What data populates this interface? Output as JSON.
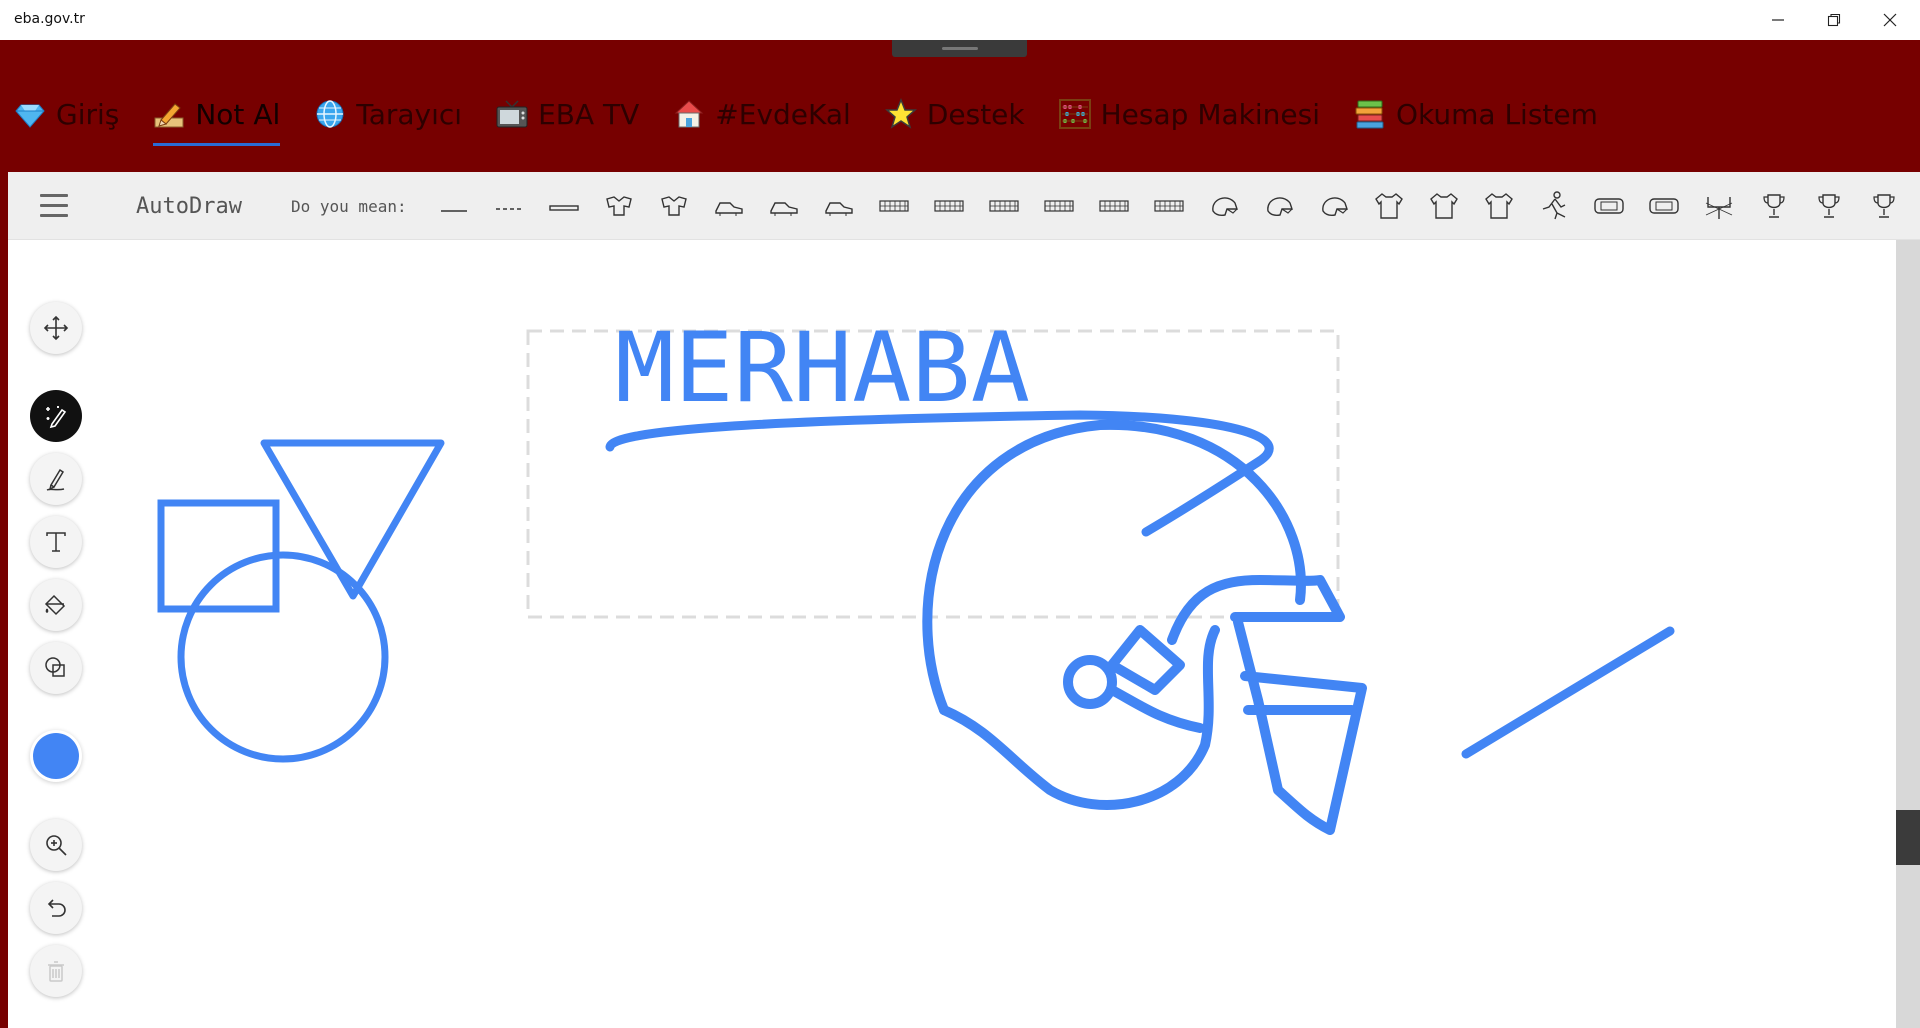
{
  "window": {
    "title": "eba.gov.tr",
    "controls": [
      "minimize",
      "restore",
      "close"
    ]
  },
  "nav": {
    "items": [
      {
        "label": "Giriş",
        "icon": "diamond-icon"
      },
      {
        "label": "Not Al",
        "icon": "pencil-icon",
        "active": true
      },
      {
        "label": "Tarayıcı",
        "icon": "globe-icon"
      },
      {
        "label": "EBA TV",
        "icon": "tv-icon"
      },
      {
        "label": "#EvdeKal",
        "icon": "house-icon"
      },
      {
        "label": "Destek",
        "icon": "star-icon"
      },
      {
        "label": "Hesap Makinesi",
        "icon": "abacus-icon"
      },
      {
        "label": "Okuma Listem",
        "icon": "books-icon"
      }
    ]
  },
  "appbar": {
    "brand": "AutoDraw",
    "suggest_label": "Do you mean:",
    "suggestions": [
      "line-icon",
      "dashed-line-icon",
      "bar-icon",
      "shoulder-pads-icon",
      "shoulder-pads-icon",
      "cleat-icon",
      "cleat-icon",
      "cleat-icon",
      "fence-icon",
      "fence-icon",
      "fence-icon",
      "fence-icon",
      "fence-icon",
      "fence-icon",
      "helmet-icon",
      "helmet-icon",
      "helmet-icon",
      "jersey-icon",
      "jersey-icon",
      "jersey-icon",
      "player-icon",
      "stadium-icon",
      "stadium-icon",
      "goalpost-icon",
      "trophy-icon",
      "trophy-icon",
      "trophy-icon",
      "ball-icon"
    ]
  },
  "tools": [
    "move-icon",
    "autodraw-icon",
    "pencil-icon",
    "text-icon",
    "fill-icon",
    "shapes-icon",
    "color-swatch",
    "zoom-icon",
    "undo-icon",
    "trash-icon"
  ],
  "canvas": {
    "text": "MERHABA",
    "stroke_color": "#4285f4"
  },
  "colors": {
    "nav_bg": "#770000",
    "accent": "#4285f4"
  }
}
